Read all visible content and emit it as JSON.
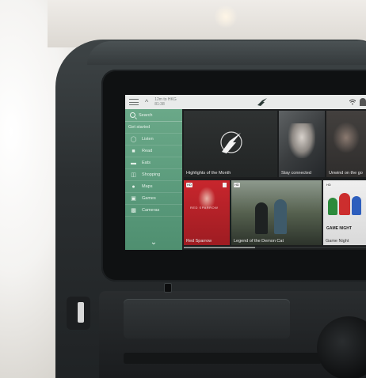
{
  "topbar": {
    "flight_line1": "12m to HKG",
    "flight_line2": "81:38"
  },
  "sidebar": {
    "search_label": "Search",
    "items": [
      {
        "label": "Get started",
        "icon": "none"
      },
      {
        "label": "Listen",
        "icon": "headphones-icon"
      },
      {
        "label": "Read",
        "icon": "book-icon"
      },
      {
        "label": "Eats",
        "icon": "food-icon"
      },
      {
        "label": "Shopping",
        "icon": "bag-icon"
      },
      {
        "label": "Maps",
        "icon": "map-pin-icon"
      },
      {
        "label": "Games",
        "icon": "gamepad-icon"
      },
      {
        "label": "Cameras",
        "icon": "camera-icon"
      }
    ]
  },
  "tiles": {
    "highlights": {
      "label": "Highlights of the Month"
    },
    "stay": {
      "label": "Stay connected"
    },
    "unwind": {
      "label": "Unwind on the go"
    },
    "redsparrow": {
      "label": "Red Sparrow",
      "badge": "HD",
      "poster_title": "RED SPARROW"
    },
    "demoncat": {
      "label": "Legend of the Demon Cat",
      "badge": "HD"
    },
    "gamenight": {
      "label": "Game Night",
      "badge": "HD",
      "poster_title": "GAME NIGHT"
    }
  },
  "colors": {
    "sidebar": "#5a9a7b",
    "topbar": "#e9ebea",
    "red_poster": "#c8262d"
  }
}
